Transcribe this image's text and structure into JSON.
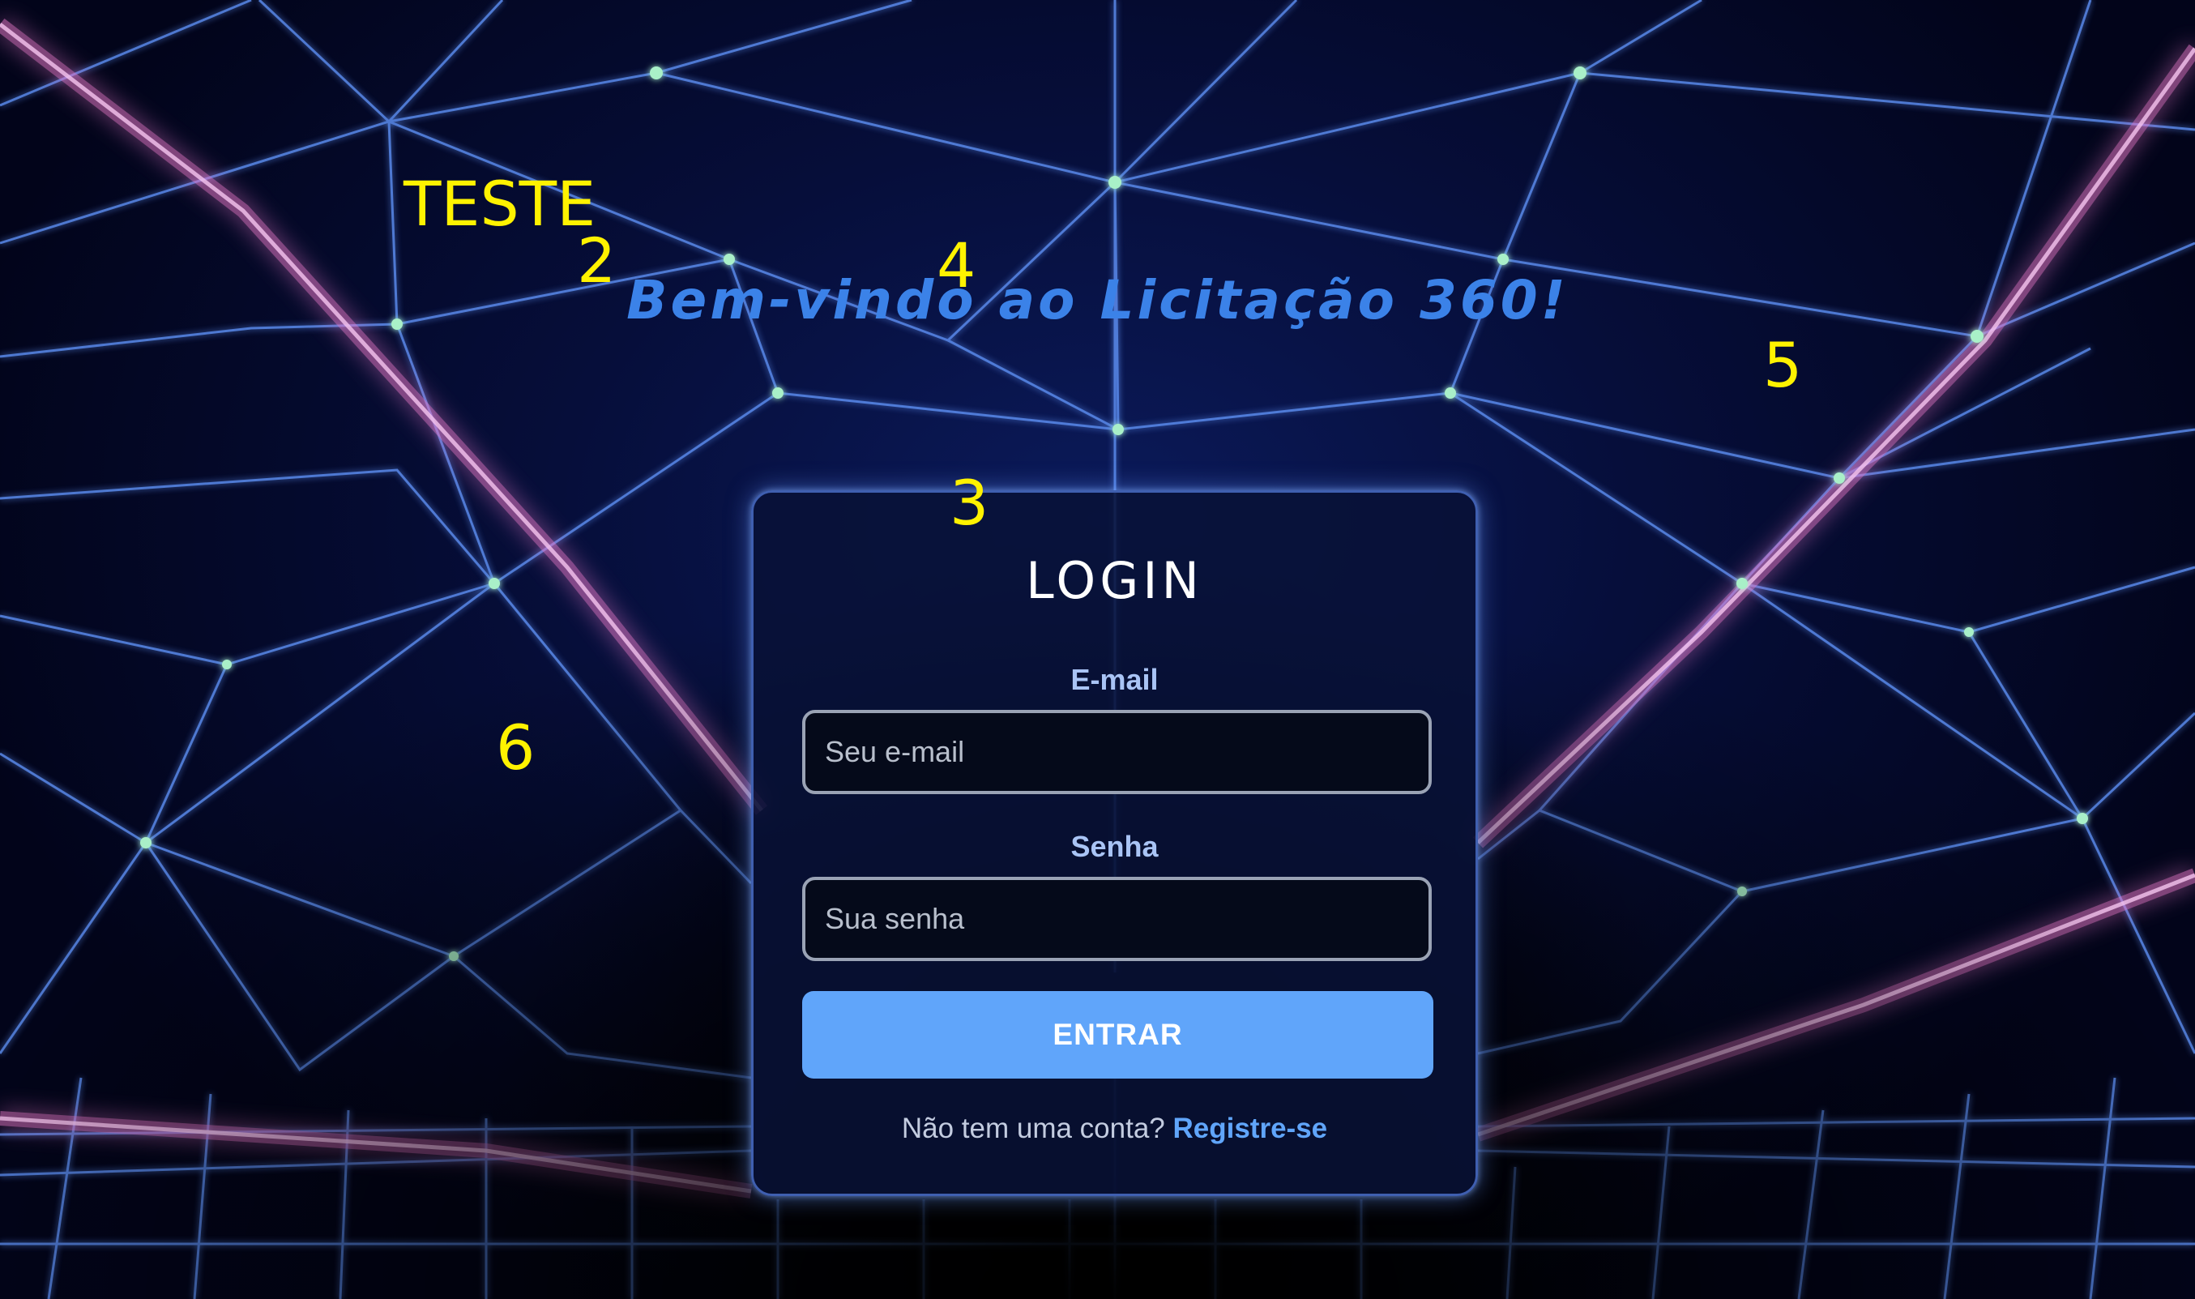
{
  "overlay_labels": {
    "teste": "TESTE",
    "n2": "2",
    "n3": "3",
    "n4": "4",
    "n5": "5",
    "n6": "6"
  },
  "welcome": {
    "text": "Bem-vindo ao Licitação 360!"
  },
  "login": {
    "title": "LOGIN",
    "email_label": "E-mail",
    "email_placeholder": "Seu e-mail",
    "email_value": "",
    "password_label": "Senha",
    "password_placeholder": "Sua senha",
    "password_value": "",
    "submit_label": "ENTRAR",
    "register_prompt": "Não tem uma conta?",
    "register_link": "Registre-se"
  },
  "colors": {
    "overlay_text": "#fff200",
    "welcome_text": "#3b82e8",
    "button": "#60a5fa",
    "link": "#60a5fa",
    "card_border": "#3f5fb0",
    "grid_lines": "#5b8df0",
    "neon_pink": "#e879c9"
  },
  "icons": {
    "background": "neon-wireframe-tunnel"
  }
}
